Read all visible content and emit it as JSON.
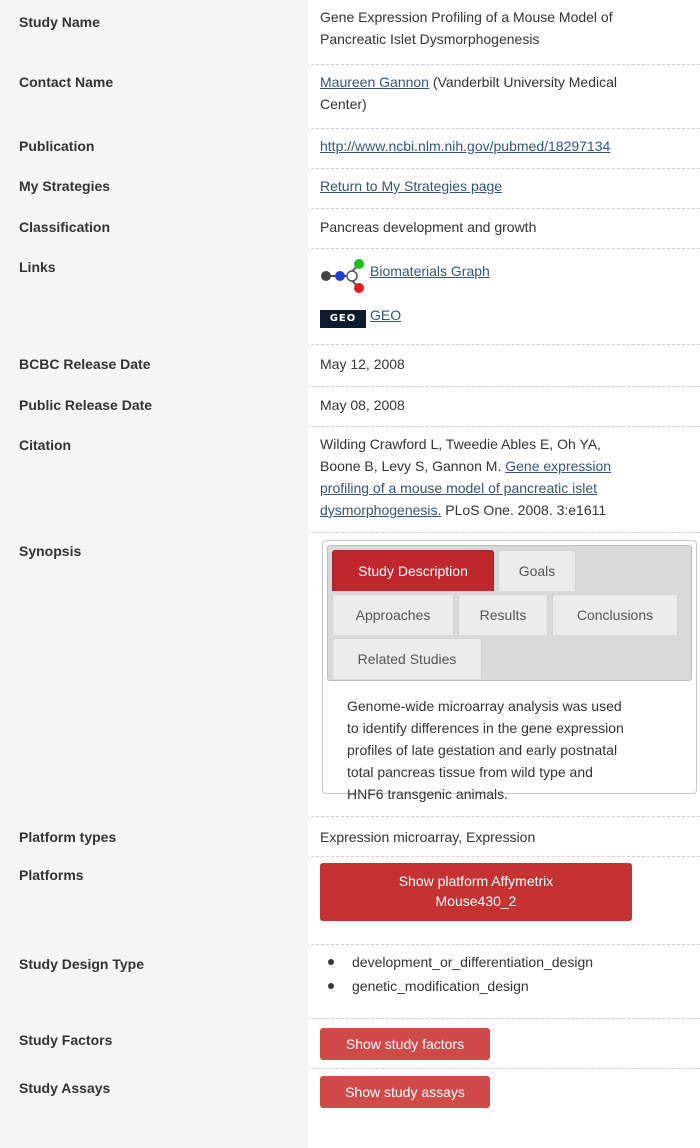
{
  "rows": {
    "study_name": {
      "label": "Study Name",
      "value_line1": "Gene Expression Profiling of a Mouse Model of",
      "value_line2": "Pancreatic Islet Dysmorphogenesis"
    },
    "contact": {
      "label": "Contact Name",
      "link": "Maureen Gannon",
      "rest_line1": " (Vanderbilt University Medical",
      "rest_line2": "Center)"
    },
    "publication": {
      "label": "Publication",
      "link": "http://www.ncbi.nlm.nih.gov/pubmed/18297134"
    },
    "my_strategies": {
      "label": "My Strategies",
      "link": "Return to My Strategies page"
    },
    "classification": {
      "label": "Classification",
      "value": "Pancreas development and growth"
    },
    "links": {
      "label": "Links",
      "biomaterials": "Biomaterials Graph",
      "geo": "GEO",
      "geo_logo_text": "GEO"
    },
    "bcbc_release": {
      "label": "BCBC Release Date",
      "value": "May 12, 2008"
    },
    "public_release": {
      "label": "Public Release Date",
      "value": "May 08, 2008"
    },
    "citation": {
      "label": "Citation",
      "line1": "Wilding Crawford L, Tweedie Ables E, Oh YA,",
      "line2a": "Boone B, Levy S, Gannon M. ",
      "link_line2": "Gene expression",
      "link_line3": "profiling of a mouse model of pancreatic islet",
      "link_line4": "dysmorphogenesis.",
      "line4_rest": " PLoS One. 2008. 3:e1611"
    },
    "synopsis": {
      "label": "Synopsis",
      "tabs": [
        "Study Description",
        "Goals",
        "Approaches",
        "Results",
        "Conclusions",
        "Related Studies"
      ],
      "body": [
        "Genome-wide microarray analysis was used",
        "to identify differences in the gene expression",
        "profiles of late gestation and early postnatal",
        "total pancreas tissue from wild type and",
        "HNF6 transgenic animals."
      ]
    },
    "platform_types": {
      "label": "Platform types",
      "value": "Expression microarray, Expression"
    },
    "platforms": {
      "label": "Platforms",
      "button_line1": "Show platform Affymetrix",
      "button_line2": "Mouse430_2"
    },
    "design_type": {
      "label": "Study Design Type",
      "items": [
        "development_or_differentiation_design",
        "genetic_modification_design"
      ]
    },
    "factors": {
      "label": "Study Factors",
      "button": "Show study factors"
    },
    "assays": {
      "label": "Study Assays",
      "button": "Show study assays"
    }
  },
  "colors": {
    "accent_red": "#c0272d",
    "link_blue": "#33557a",
    "label_bg": "#f5f5f5"
  }
}
